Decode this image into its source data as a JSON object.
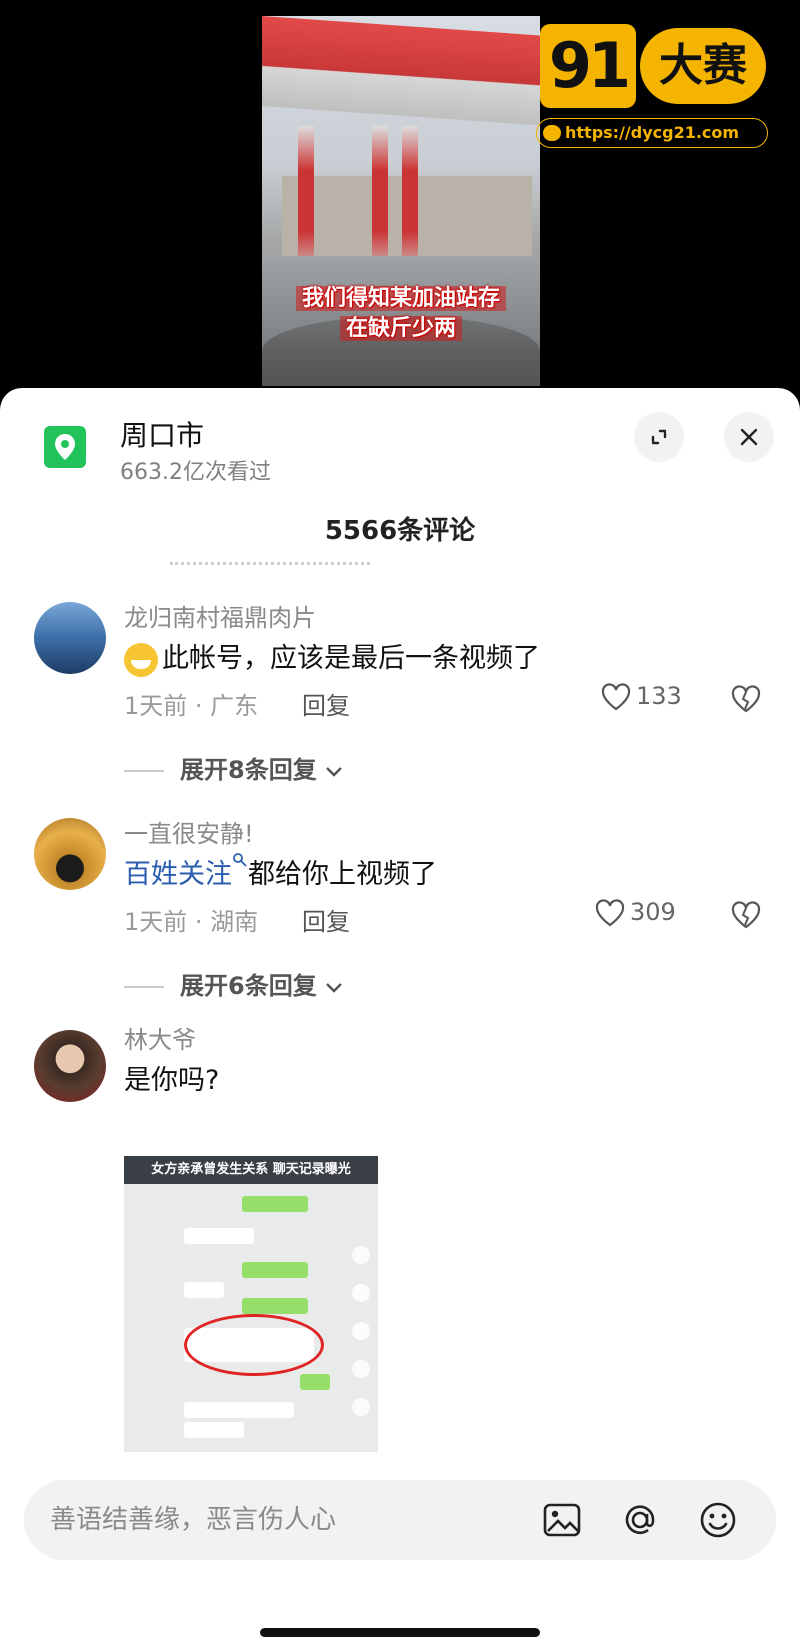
{
  "video": {
    "subtitle_line1": "我们得知某加油站存",
    "subtitle_line2": "在缺斤少两"
  },
  "watermark": {
    "logo_number": "91",
    "logo_text": "大赛",
    "url": "https://dycg21.com"
  },
  "header": {
    "location": "周口市",
    "views": "663.2亿次看过",
    "expand_icon": "expand-icon",
    "close_icon": "close-icon",
    "accent": "#21c35a"
  },
  "comment_count": "5566条评论",
  "comments": [
    {
      "user": "龙归南村福鼎肉片",
      "text": "此帐号，应该是最后一条视频了",
      "time_location": "1天前 · 广东",
      "reply_label": "回复",
      "likes": "133",
      "expand_label": "展开8条回复"
    },
    {
      "user": "一直很安静!",
      "link_text": "百姓关注",
      "text": "都给你上视频了",
      "time_location": "1天前 · 湖南",
      "reply_label": "回复",
      "likes": "309",
      "expand_label": "展开6条回复"
    },
    {
      "user": "林大爷",
      "text": "是你吗?",
      "image_caption": "女方亲承曾发生关系 聊天记录曝光"
    }
  ],
  "input": {
    "placeholder": "善语结善缘，恶言伤人心"
  },
  "link_color": "#2a5db0"
}
